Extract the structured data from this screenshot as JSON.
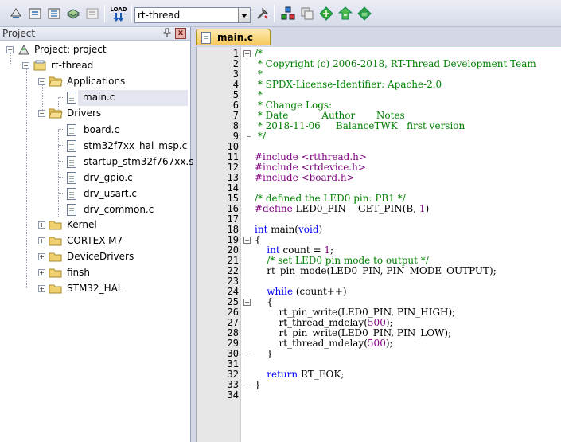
{
  "toolbar": {
    "target_select_value": "rt-thread",
    "buttons": [
      "translate-icon",
      "build-icon",
      "rebuild-icon",
      "batch-build-icon",
      "stop-build-icon",
      "download-icon",
      "target-options-icon",
      "manage-components-icon",
      "file-extensions-icon",
      "select-packs-icon",
      "pack-installer-icon",
      "run-time-environment-icon"
    ],
    "load_label": "LOAD"
  },
  "project_panel": {
    "title": "Project",
    "pin_label": "»",
    "close_label": "x",
    "tree": {
      "root": "Project: project",
      "target": "rt-thread",
      "groups": [
        {
          "label": "Applications",
          "files": [
            "main.c"
          ]
        },
        {
          "label": "Drivers",
          "files": [
            "board.c",
            "stm32f7xx_hal_msp.c",
            "startup_stm32f767xx.s",
            "drv_gpio.c",
            "drv_usart.c",
            "drv_common.c"
          ]
        },
        {
          "label": "Kernel",
          "files": []
        },
        {
          "label": "CORTEX-M7",
          "files": []
        },
        {
          "label": "DeviceDrivers",
          "files": []
        },
        {
          "label": "finsh",
          "files": []
        },
        {
          "label": "STM32_HAL",
          "files": []
        }
      ]
    }
  },
  "editor": {
    "tab_label": "main.c",
    "lines": [
      {
        "n": "1",
        "t": "/*"
      },
      {
        "n": "2",
        "t": " * Copyright (c) 2006-2018, RT-Thread Development Team"
      },
      {
        "n": "3",
        "t": " *"
      },
      {
        "n": "4",
        "t": " * SPDX-License-Identifier: Apache-2.0"
      },
      {
        "n": "5",
        "t": " *"
      },
      {
        "n": "6",
        "t": " * Change Logs:"
      },
      {
        "n": "7",
        "t": " * Date           Author       Notes"
      },
      {
        "n": "8",
        "t": " * 2018-11-06     BalanceTWK   first version"
      },
      {
        "n": "9",
        "t": " */"
      },
      {
        "n": "10",
        "t": ""
      },
      {
        "n": "11",
        "t": "#include <rtthread.h>"
      },
      {
        "n": "12",
        "t": "#include <rtdevice.h>"
      },
      {
        "n": "13",
        "t": "#include <board.h>"
      },
      {
        "n": "14",
        "t": ""
      },
      {
        "n": "15",
        "t": "/* defined the LED0 pin: PB1 */"
      },
      {
        "n": "16",
        "t": "#define LED0_PIN    GET_PIN(B, 1)"
      },
      {
        "n": "17",
        "t": ""
      },
      {
        "n": "18",
        "t": "int main(void)"
      },
      {
        "n": "19",
        "t": "{"
      },
      {
        "n": "20",
        "t": "    int count = 1;"
      },
      {
        "n": "21",
        "t": "    /* set LED0 pin mode to output */"
      },
      {
        "n": "22",
        "t": "    rt_pin_mode(LED0_PIN, PIN_MODE_OUTPUT);"
      },
      {
        "n": "23",
        "t": ""
      },
      {
        "n": "24",
        "t": "    while (count++)"
      },
      {
        "n": "25",
        "t": "    {"
      },
      {
        "n": "26",
        "t": "        rt_pin_write(LED0_PIN, PIN_HIGH);"
      },
      {
        "n": "27",
        "t": "        rt_thread_mdelay(500);"
      },
      {
        "n": "28",
        "t": "        rt_pin_write(LED0_PIN, PIN_LOW);"
      },
      {
        "n": "29",
        "t": "        rt_thread_mdelay(500);"
      },
      {
        "n": "30",
        "t": "    }"
      },
      {
        "n": "31",
        "t": ""
      },
      {
        "n": "32",
        "t": "    return RT_EOK;"
      },
      {
        "n": "33",
        "t": "}"
      },
      {
        "n": "34",
        "t": ""
      }
    ]
  },
  "colors": {
    "comment": "#008000",
    "preprocessor": "#800080",
    "keyword": "#0000ff",
    "string": "#7f007f",
    "tab_active": "#f6c85a"
  }
}
